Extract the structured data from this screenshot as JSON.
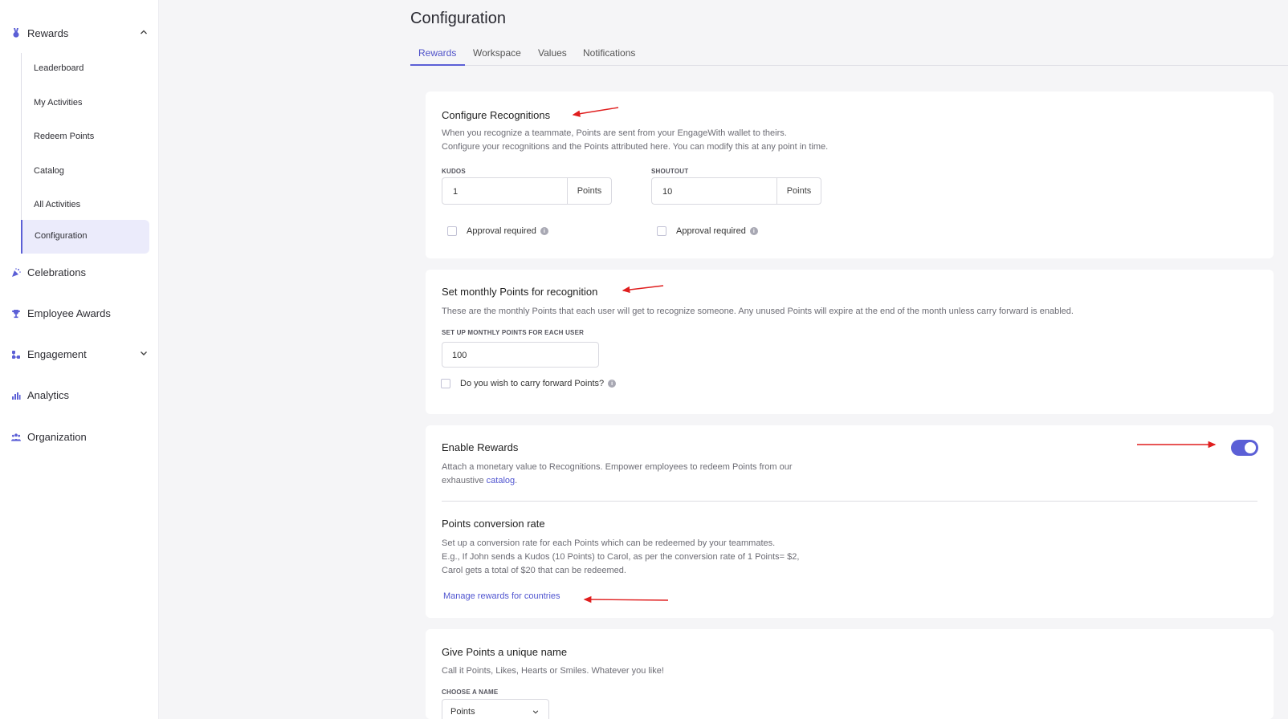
{
  "sidebar": {
    "rewards": {
      "label": "Rewards",
      "icon": "medal-icon"
    },
    "sub_items": [
      "Leaderboard",
      "My Activities",
      "Redeem Points",
      "Catalog",
      "All Activities",
      "Configuration"
    ],
    "items": [
      {
        "label": "Celebrations",
        "icon": "party-popper-icon"
      },
      {
        "label": "Employee Awards",
        "icon": "trophy-icon"
      },
      {
        "label": "Engagement",
        "icon": "engagement-icon"
      },
      {
        "label": "Analytics",
        "icon": "bar-chart-icon"
      },
      {
        "label": "Organization",
        "icon": "people-icon"
      }
    ]
  },
  "page": {
    "title": "Configuration",
    "tabs": [
      "Rewards",
      "Workspace",
      "Values",
      "Notifications"
    ],
    "active_tab": "Rewards"
  },
  "recognitions": {
    "title": "Configure Recognitions",
    "desc_line1": "When you recognize a teammate, Points are sent from your EngageWith wallet to theirs.",
    "desc_line2": "Configure your recognitions and the Points attributed here. You can modify this at any point in time.",
    "kudos": {
      "label": "KUDOS",
      "value": "1",
      "suffix": "Points",
      "approval": "Approval required"
    },
    "shoutout": {
      "label": "SHOUTOUT",
      "value": "10",
      "suffix": "Points",
      "approval": "Approval required"
    }
  },
  "monthly": {
    "title": "Set monthly Points for recognition",
    "desc": "These are the monthly Points that each user will get to recognize someone. Any unused Points will expire at the end of the month unless carry forward is enabled.",
    "field_label": "SET UP MONTHLY POINTS FOR EACH USER",
    "value": "100",
    "carry_forward": "Do you wish to carry forward Points?"
  },
  "enable_rewards": {
    "title": "Enable Rewards",
    "desc_line1": "Attach a monetary value to Recognitions. Empower employees to redeem Points from our",
    "desc_line2_pre": "exhaustive ",
    "desc_link": "catalog",
    "desc_line2_post": ".",
    "enabled": true,
    "conversion_title": "Points conversion rate",
    "conv_line1": "Set up a conversion rate for each Points which can be redeemed by your teammates.",
    "conv_line2": "E.g., If John sends a Kudos (10 Points) to Carol, as per the conversion rate of 1 Points= $2,",
    "conv_line3": "Carol gets a total of $20 that can be redeemed.",
    "manage_link": "Manage rewards for countries"
  },
  "unique_name": {
    "title": "Give Points a unique name",
    "desc": "Call it Points, Likes, Hearts or Smiles. Whatever you like!",
    "field_label": "CHOOSE A NAME",
    "selected": "Points"
  },
  "colors": {
    "accent": "#5b5fd6",
    "annotation": "#e01e1e"
  }
}
